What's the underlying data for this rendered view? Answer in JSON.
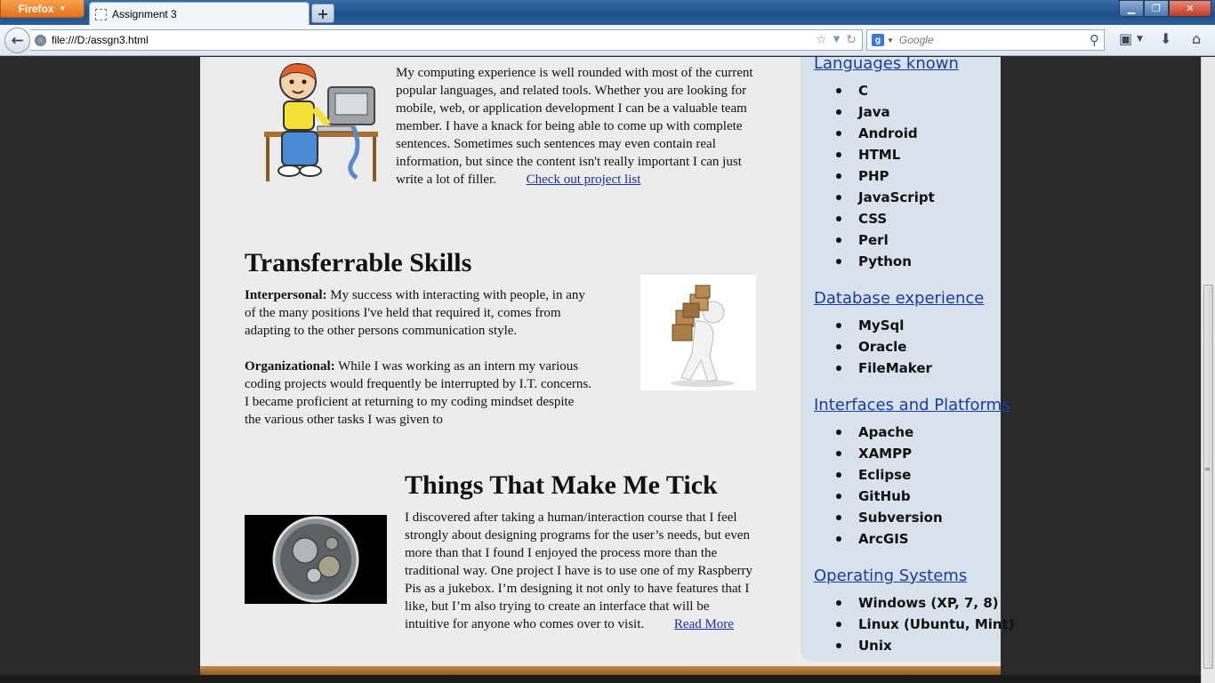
{
  "browser": {
    "app_button": "Firefox",
    "tab_title": "Assignment 3",
    "new_tab": "+",
    "url": "file:///D:/assgn3.html",
    "search_placeholder": "Google",
    "search_engine_letter": "g"
  },
  "computing": {
    "paragraph": "My computing experience is well rounded with most of the current popular languages, and related tools. Whether you are looking for mobile, web, or application development I can be a valuable team member. I have a knack for being able to come up with complete sentences. Sometimes such sentences may even contain real information, but since the content isn't really important I can just write a lot of filler.",
    "link": "Check out project list"
  },
  "skills": {
    "heading": "Transferrable Skills",
    "interpersonal_label": "Interpersonal:",
    "interpersonal_text": " My success with interacting with people, in any of the many positions I've held that required it, comes from adapting to the other persons communication style.",
    "organizational_label": "Organizational:",
    "organizational_text": " While I was working as an intern my various coding projects would frequently be interrupted by I.T. concerns. I became proficient at returning to my coding mindset despite the various other tasks I was given to"
  },
  "tick": {
    "heading": "Things That Make Me Tick",
    "paragraph": "I discovered after taking a human/interaction course that I feel strongly about designing programs for the user’s needs, but even more than that I found I enjoyed the process more than the traditional way. One project I have is to use one of my Raspberry Pis as a jukebox. I’m designing it not only to have features that I like, but I’m also trying to create an interface that will be intuitive for anyone who comes over to visit.",
    "link": "Read More"
  },
  "sidebar": {
    "sections": [
      {
        "heading": "Languages known",
        "items": [
          "C",
          "Java",
          "Android",
          "HTML",
          "PHP",
          "JavaScript",
          "CSS",
          "Perl",
          "Python"
        ]
      },
      {
        "heading": "Database experience",
        "items": [
          "MySql",
          "Oracle",
          "FileMaker"
        ]
      },
      {
        "heading": "Interfaces and Platforms",
        "items": [
          "Apache",
          "XAMPP",
          "Eclipse",
          "GitHub",
          "Subversion",
          "ArcGIS"
        ]
      },
      {
        "heading": "Operating Systems",
        "items": [
          "Windows (XP, 7, 8)",
          "Linux (Ubuntu, Mint)",
          "Unix"
        ]
      }
    ]
  },
  "colors": {
    "link": "#1a2ea8",
    "sidebar_bg": "#d8e1ec",
    "content_bg": "#ececec",
    "firefox_orange": "#e5701a"
  }
}
